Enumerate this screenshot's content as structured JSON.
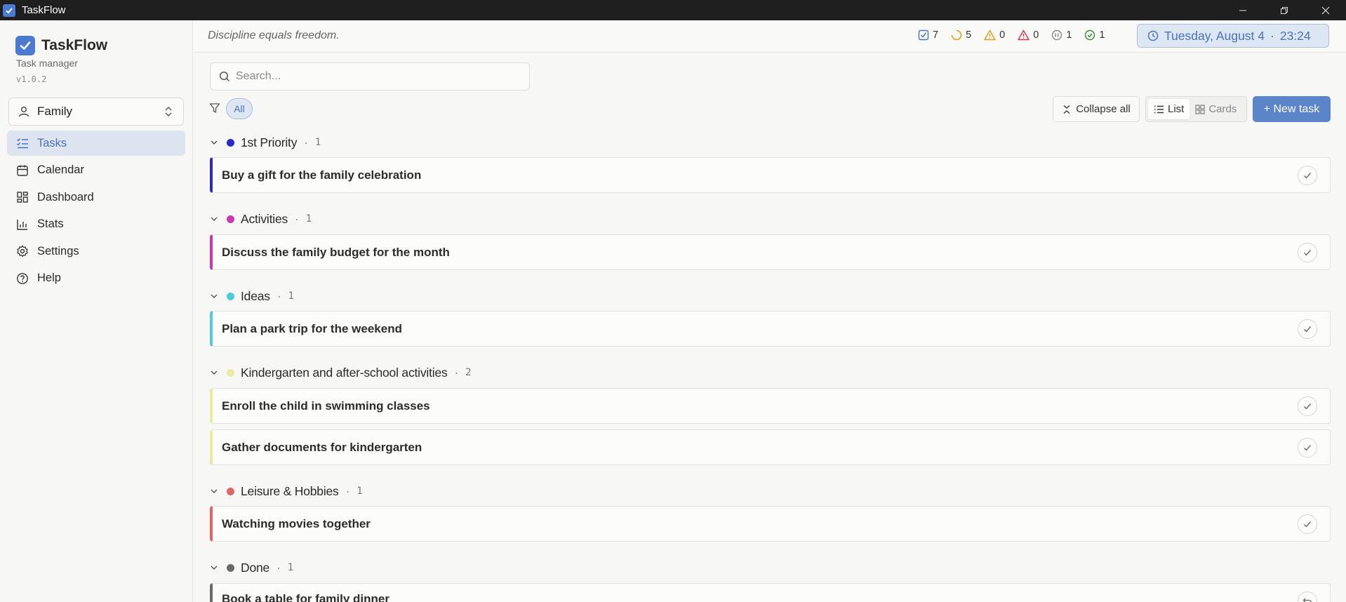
{
  "window": {
    "title": "TaskFlow"
  },
  "sidebar": {
    "app_name": "TaskFlow",
    "subtitle": "Task manager",
    "version": "v1.0.2",
    "workspace": "Family",
    "nav": [
      {
        "label": "Tasks",
        "icon": "list-check-icon",
        "active": true
      },
      {
        "label": "Calendar",
        "icon": "calendar-icon"
      },
      {
        "label": "Dashboard",
        "icon": "dashboard-icon"
      },
      {
        "label": "Stats",
        "icon": "bar-chart-icon"
      },
      {
        "label": "Settings",
        "icon": "gear-icon"
      },
      {
        "label": "Help",
        "icon": "help-circle-icon"
      }
    ]
  },
  "header": {
    "quote": "Discipline equals freedom.",
    "stats": [
      {
        "icon": "checkbox-icon",
        "value": "7",
        "color": "#4a72b8"
      },
      {
        "icon": "in-progress-icon",
        "value": "5",
        "color": "#d4a017"
      },
      {
        "icon": "warning-icon",
        "value": "0",
        "color": "#d4a017"
      },
      {
        "icon": "alert-icon",
        "value": "0",
        "color": "#d0364a"
      },
      {
        "icon": "paused-icon",
        "value": "1",
        "color": "#888888"
      },
      {
        "icon": "done-icon",
        "value": "1",
        "color": "#3a8a3a"
      }
    ],
    "date": "Tuesday, August 4",
    "separator": "·",
    "time": "23:24"
  },
  "toolbar": {
    "search_placeholder": "Search...",
    "filter_all": "All",
    "collapse_label": "Collapse all",
    "view_list": "List",
    "view_cards": "Cards",
    "new_task": "+ New task"
  },
  "groups": [
    {
      "name": "1st Priority",
      "count": "1",
      "color": "#2a2ac8",
      "tasks": [
        "Buy a gift for the family celebration"
      ]
    },
    {
      "name": "Activities",
      "count": "1",
      "color": "#c83aae",
      "tasks": [
        "Discuss the family budget for the month"
      ]
    },
    {
      "name": "Ideas",
      "count": "1",
      "color": "#4ecbd4",
      "tasks": [
        "Plan a park trip for the weekend"
      ]
    },
    {
      "name": "Kindergarten and after-school activities",
      "count": "2",
      "color": "#ece9a0",
      "tasks": [
        "Enroll the child in swimming classes",
        "Gather documents for kindergarten"
      ]
    },
    {
      "name": "Leisure & Hobbies",
      "count": "1",
      "color": "#e06666",
      "tasks": [
        "Watching movies together"
      ]
    },
    {
      "name": "Done",
      "count": "1",
      "color": "#6a6a6a",
      "tasks": [
        "Book a table for family dinner"
      ]
    }
  ]
}
